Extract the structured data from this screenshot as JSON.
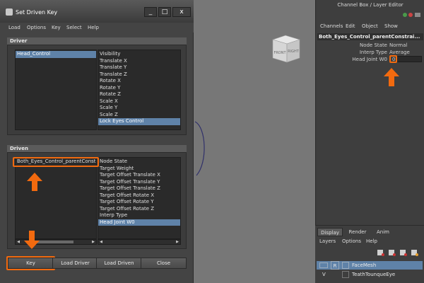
{
  "viewcube": {
    "front": "FRONT",
    "right": "RIGHT"
  },
  "dialog": {
    "title": "Set Driven Key",
    "window_buttons": {
      "minimize": "_",
      "maximize": "□",
      "close": "x"
    },
    "menu": [
      "Load",
      "Options",
      "Key",
      "Select",
      "Help"
    ],
    "driver": {
      "header": "Driver",
      "objects": [
        {
          "label": "Head_Control",
          "selected": true
        }
      ],
      "attributes": [
        {
          "label": "Visibility",
          "selected": false
        },
        {
          "label": "Translate X",
          "selected": false
        },
        {
          "label": "Translate Y",
          "selected": false
        },
        {
          "label": "Translate Z",
          "selected": false
        },
        {
          "label": "Rotate X",
          "selected": false
        },
        {
          "label": "Rotate Y",
          "selected": false
        },
        {
          "label": "Rotate Z",
          "selected": false
        },
        {
          "label": "Scale X",
          "selected": false
        },
        {
          "label": "Scale Y",
          "selected": false
        },
        {
          "label": "Scale Z",
          "selected": false
        },
        {
          "label": "Lock Eyes Control",
          "selected": true
        }
      ]
    },
    "driven": {
      "header": "Driven",
      "objects": [
        {
          "label": "Both_Eyes_Control_parentConstrai",
          "selected": false
        }
      ],
      "attributes": [
        {
          "label": "Node State",
          "selected": false
        },
        {
          "label": "Target Weight",
          "selected": false
        },
        {
          "label": "Target Offset Translate X",
          "selected": false
        },
        {
          "label": "Target Offset Translate Y",
          "selected": false
        },
        {
          "label": "Target Offset Translate Z",
          "selected": false
        },
        {
          "label": "Target Offset Rotate X",
          "selected": false
        },
        {
          "label": "Target Offset Rotate Y",
          "selected": false
        },
        {
          "label": "Target Offset Rotate Z",
          "selected": false
        },
        {
          "label": "Interp Type",
          "selected": false
        },
        {
          "label": "Head Joint W0",
          "selected": true
        }
      ]
    },
    "buttons": {
      "key": "Key",
      "load_driver": "Load Driver",
      "load_driven": "Load Driven",
      "close": "Close"
    }
  },
  "channel_box": {
    "title": "Channel Box / Layer Editor",
    "menu": [
      "Channels",
      "Edit",
      "Object",
      "Show"
    ],
    "object_name": "Both_Eyes_Control_parentConstrai...",
    "attributes": [
      {
        "label": "Node State",
        "value": "Normal"
      },
      {
        "label": "Interp Type",
        "value": "Average"
      },
      {
        "label": "Head Joint W0",
        "value": "0"
      }
    ]
  },
  "layer_editor": {
    "tabs": [
      "Display",
      "Render",
      "Anim"
    ],
    "active_tab": "Display",
    "menu": [
      "Layers",
      "Options",
      "Help"
    ],
    "layers": [
      {
        "visible": "",
        "ref": "R",
        "name": "FaceMesh",
        "selected": true
      },
      {
        "visible": "V",
        "ref": "",
        "name": "TeathTounqueEye",
        "selected": false
      }
    ]
  },
  "colors": {
    "highlight": "#f26a0f",
    "selection": "#5f82a8",
    "panel": "#444444"
  }
}
